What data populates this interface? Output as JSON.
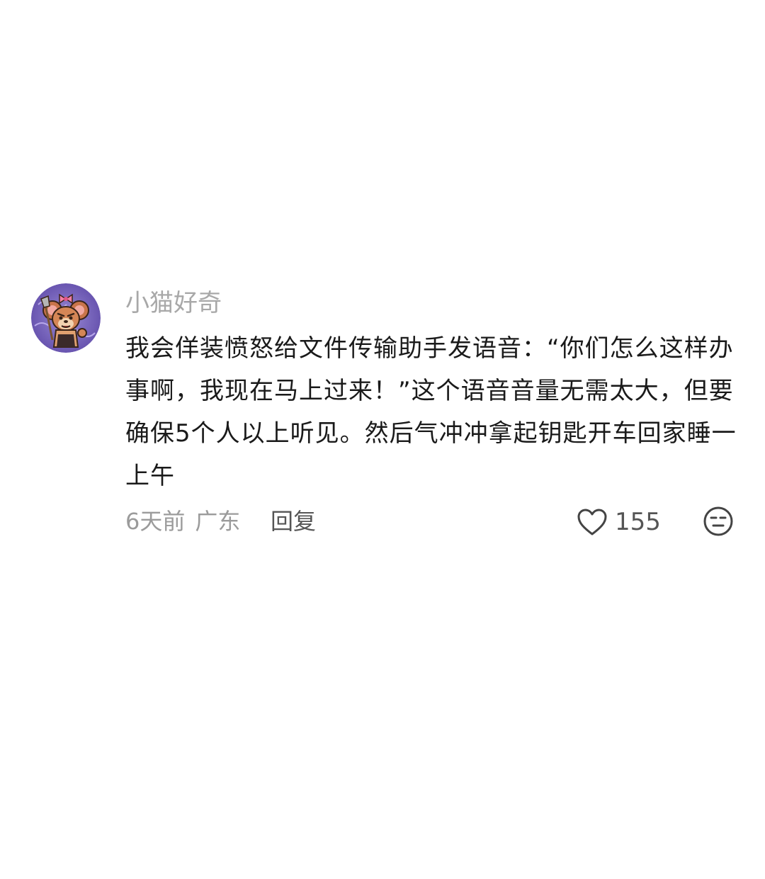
{
  "comment": {
    "username": "小猫好奇",
    "avatar_icon": "cartoon-mouse-avatar",
    "text": "我会佯装愤怒给文件传输助手发语音：“你们怎么这样办事啊，我现在马上过来！”这个语音音量无需太大，但要确保5个人以上听见。然后气冲冲拿起钥匙开车回家睡一上午",
    "time": "6天前",
    "location": "广东",
    "reply_label": "回复",
    "like_icon": "heart-outline-icon",
    "like_count": "155",
    "dislike_icon": "neutral-face-icon"
  }
}
